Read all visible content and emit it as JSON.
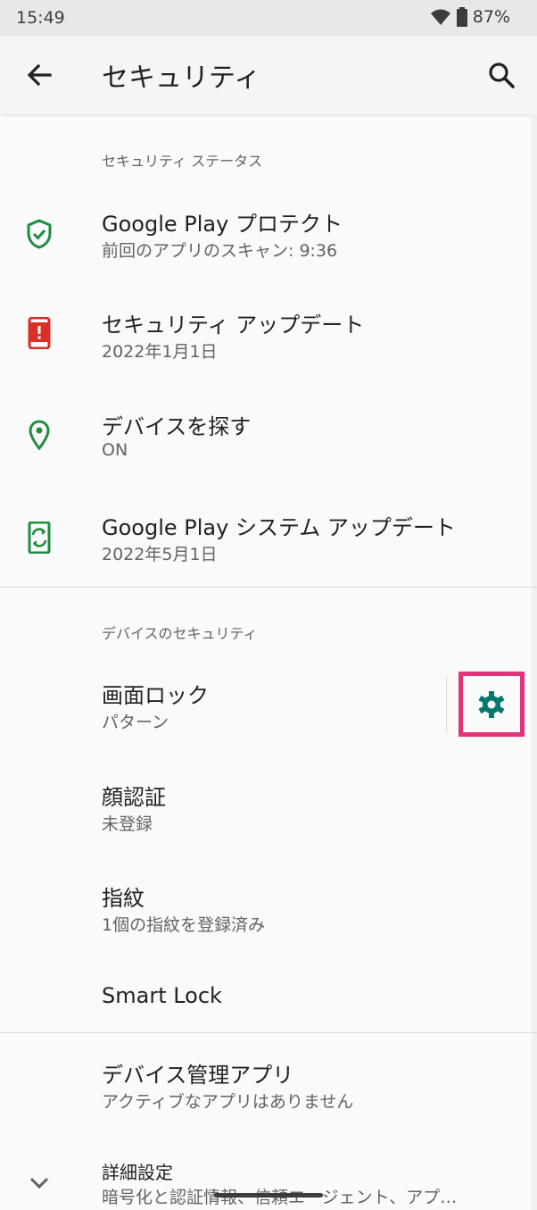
{
  "status_bar": {
    "time": "15:49",
    "battery": "87%"
  },
  "app_bar": {
    "title": "セキュリティ"
  },
  "sections": {
    "security_status": "セキュリティ ステータス",
    "device_security": "デバイスのセキュリティ"
  },
  "items": {
    "play_protect": {
      "title": "Google Play プロテクト",
      "subtitle": "前回のアプリのスキャン: 9:36"
    },
    "security_update": {
      "title": "セキュリティ アップデート",
      "subtitle": "2022年1月1日"
    },
    "find_device": {
      "title": "デバイスを探す",
      "subtitle": "ON"
    },
    "system_update": {
      "title": "Google Play システム アップデート",
      "subtitle": "2022年5月1日"
    },
    "screen_lock": {
      "title": "画面ロック",
      "subtitle": "パターン"
    },
    "face_auth": {
      "title": "顔認証",
      "subtitle": "未登録"
    },
    "fingerprint": {
      "title": "指紋",
      "subtitle": "1個の指紋を登録済み"
    },
    "smart_lock": {
      "title": "Smart Lock"
    },
    "device_admin": {
      "title": "デバイス管理アプリ",
      "subtitle": "アクティブなアプリはありません"
    },
    "advanced": {
      "title": "詳細設定",
      "subtitle": "暗号化と認証情報、信頼エージェント、アプ…"
    }
  },
  "colors": {
    "green": "#1e8e3e",
    "red": "#d93025",
    "teal": "#00796b",
    "highlight": "#e5337a"
  },
  "icons": [
    "back-arrow-icon",
    "search-icon",
    "shield-check-icon",
    "phone-alert-icon",
    "location-pin-icon",
    "phone-update-icon",
    "gear-icon",
    "chevron-down-icon",
    "wifi-icon",
    "battery-icon"
  ]
}
